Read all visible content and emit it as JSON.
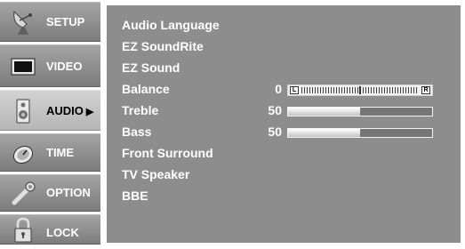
{
  "menu": [
    {
      "id": "setup",
      "label": "SETUP",
      "icon": "satellite-dish-icon"
    },
    {
      "id": "video",
      "label": "VIDEO",
      "icon": "tv-screen-icon"
    },
    {
      "id": "audio",
      "label": "AUDIO",
      "icon": "speaker-icon",
      "active": true,
      "arrow": "▶"
    },
    {
      "id": "time",
      "label": "TIME",
      "icon": "clock-icon"
    },
    {
      "id": "option",
      "label": "OPTION",
      "icon": "wrench-icon"
    },
    {
      "id": "lock",
      "label": "LOCK",
      "icon": "padlock-icon"
    }
  ],
  "audio_menu": {
    "items": [
      {
        "label": "Audio Language"
      },
      {
        "label": "EZ SoundRite"
      },
      {
        "label": "EZ Sound"
      },
      {
        "label": "Balance",
        "value": "0",
        "control": "balance",
        "left_tag": "L",
        "right_tag": "R",
        "balance_position": 0
      },
      {
        "label": "Treble",
        "value": "50",
        "control": "bar",
        "level": 0.5
      },
      {
        "label": "Bass",
        "value": "50",
        "control": "bar",
        "level": 0.5
      },
      {
        "label": "Front Surround"
      },
      {
        "label": "TV Speaker"
      },
      {
        "label": "BBE"
      }
    ]
  },
  "colors": {
    "panel": "#8d8d8d",
    "menu_active": "#c4c4c4",
    "menu_inactive": "#8e8e8e",
    "text": "#ffffff"
  }
}
